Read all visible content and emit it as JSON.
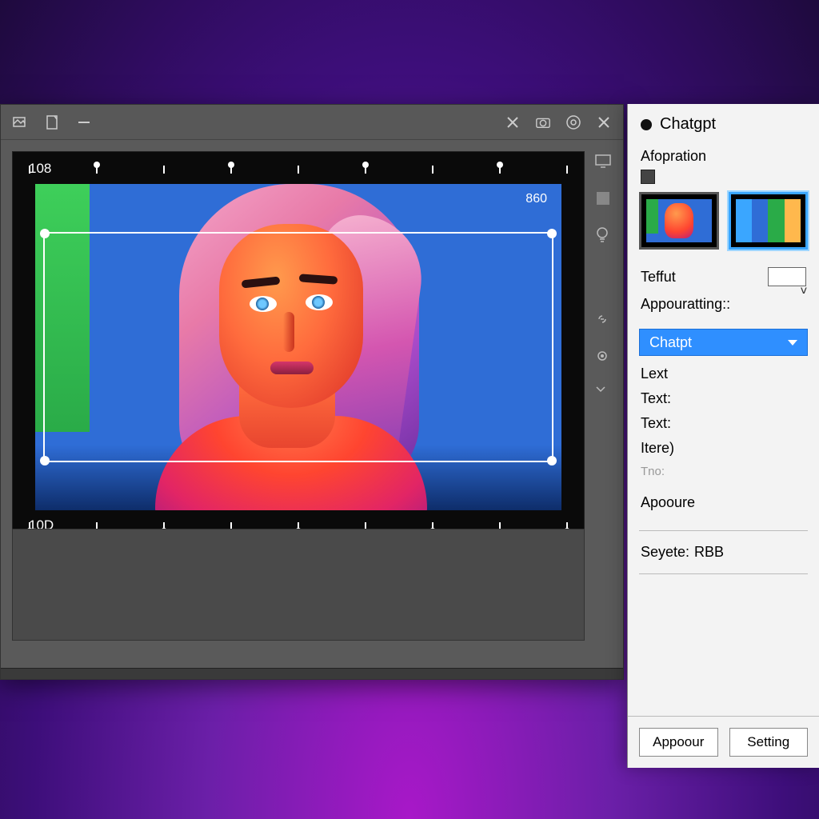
{
  "editor": {
    "ruler_top_left": "108",
    "ruler_bottom_left": "10D",
    "dim_right": "860"
  },
  "panel": {
    "title": "Chatgpt",
    "section_heading": "Afopration",
    "field_teffut": "Teffut",
    "label_appourating": "Appouratting::",
    "select_value": "Chatpt",
    "list": {
      "lext": "Lext",
      "text1": "Text:",
      "text2": "Text:",
      "itere": "Itere)",
      "tno": "Tno:"
    },
    "apooure": "Apooure",
    "seyete_label": "Seyete:",
    "seyete_value": "RBB",
    "btn_appoour": "Appoour",
    "btn_setting": "Setting"
  }
}
